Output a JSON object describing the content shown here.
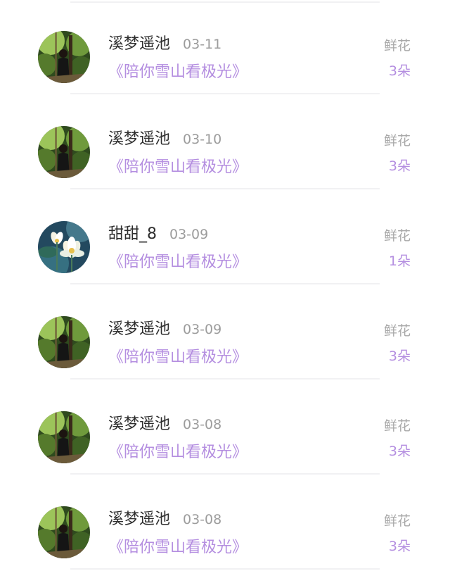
{
  "colors": {
    "accent": "#b48ee0",
    "name": "#2e2e2e",
    "muted": "#a9a9a9"
  },
  "records": [
    {
      "user": "溪梦遥池",
      "date": "03-11",
      "title": "《陪你雪山看极光》",
      "gift": "鲜花",
      "count": "3朵",
      "avatar_icon": "forest-portrait-avatar"
    },
    {
      "user": "溪梦遥池",
      "date": "03-10",
      "title": "《陪你雪山看极光》",
      "gift": "鲜花",
      "count": "3朵",
      "avatar_icon": "forest-portrait-avatar"
    },
    {
      "user": "甜甜_8",
      "date": "03-09",
      "title": "《陪你雪山看极光》",
      "gift": "鲜花",
      "count": "1朵",
      "avatar_icon": "lotus-flower-avatar"
    },
    {
      "user": "溪梦遥池",
      "date": "03-09",
      "title": "《陪你雪山看极光》",
      "gift": "鲜花",
      "count": "3朵",
      "avatar_icon": "forest-portrait-avatar"
    },
    {
      "user": "溪梦遥池",
      "date": "03-08",
      "title": "《陪你雪山看极光》",
      "gift": "鲜花",
      "count": "3朵",
      "avatar_icon": "forest-portrait-avatar"
    },
    {
      "user": "溪梦遥池",
      "date": "03-08",
      "title": "《陪你雪山看极光》",
      "gift": "鲜花",
      "count": "3朵",
      "avatar_icon": "forest-portrait-avatar"
    }
  ]
}
